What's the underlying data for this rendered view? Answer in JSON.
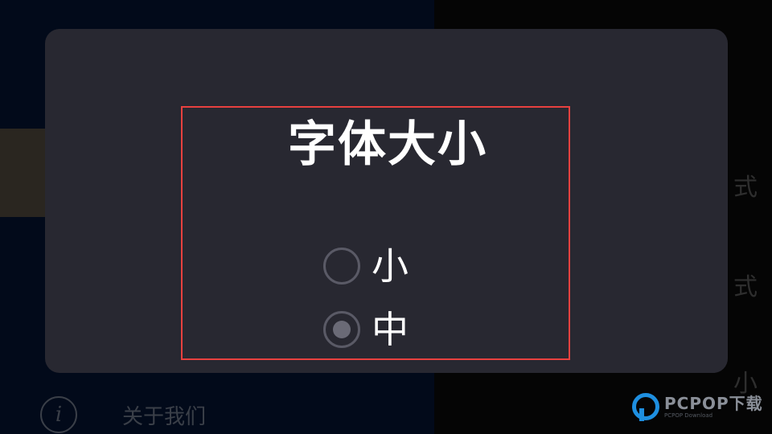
{
  "background": {
    "menu": [
      {
        "label": "",
        "icon": "info-icon"
      },
      {
        "label": "关于我们",
        "icon": "info-icon"
      }
    ],
    "right_texts": [
      "式",
      "式",
      "小"
    ]
  },
  "dialog": {
    "title": "字体大小",
    "options": [
      {
        "label": "小",
        "selected": false
      },
      {
        "label": "中",
        "selected": true
      }
    ]
  },
  "watermark": {
    "main": "PCPOP下载",
    "sub": "PCPOP Download"
  },
  "colors": {
    "dialog_bg": "#282831",
    "highlight_border": "#e8413f",
    "accent": "#1e8fe0"
  }
}
